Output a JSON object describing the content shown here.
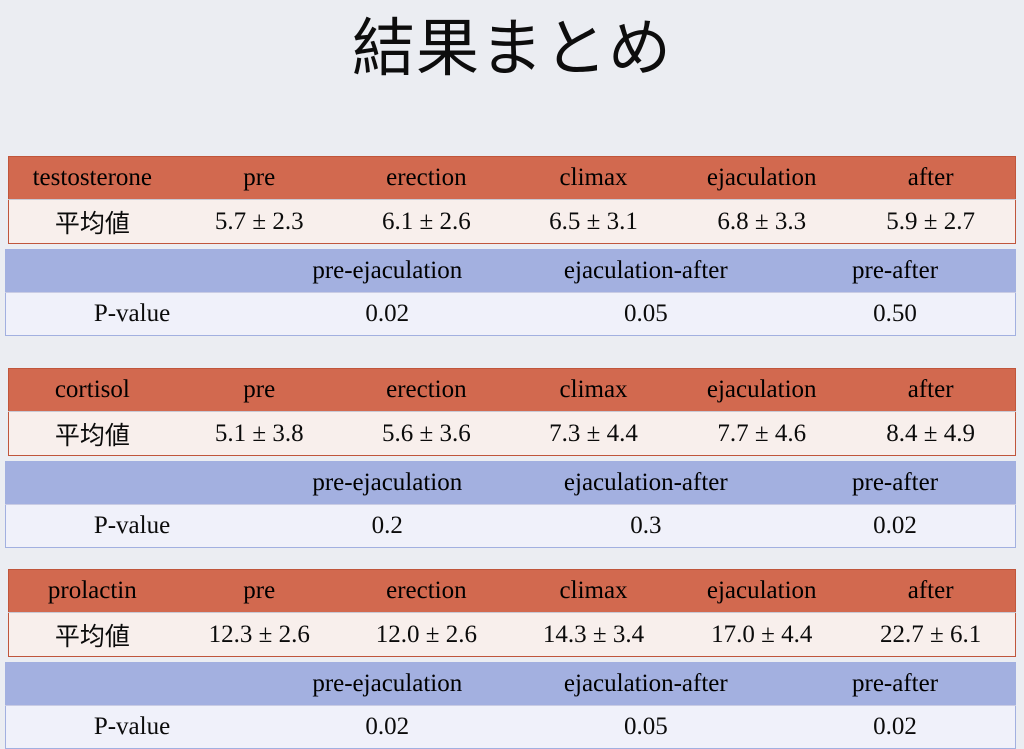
{
  "slide": {
    "title": "結果まとめ",
    "background_color": "#ebedf2",
    "header_orange": "#d2694f",
    "row_orange": "#f8efec",
    "header_blue": "#a3b0e0",
    "row_blue": "#f0f1fa",
    "significant_color": "#ff0000",
    "nonsignificant_color": "#2222ee"
  },
  "common": {
    "phase_headers": [
      "pre",
      "erection",
      "climax",
      "ejaculation",
      "after"
    ],
    "mean_label": "平均値",
    "pvalue_label": "P-value",
    "comparison_headers": [
      "pre-ejaculation",
      "ejaculation-after",
      "pre-after"
    ]
  },
  "tables": [
    {
      "hormone": "testosterone",
      "mean_row": {
        "label": "平均値",
        "values": [
          "5.7 ± 2.3",
          "6.1 ± 2.6",
          "6.5 ± 3.1",
          "6.8 ± 3.3",
          "5.9 ± 2.7"
        ]
      },
      "pvalue_row": {
        "label": "P-value",
        "values": [
          "0.02",
          "0.05",
          "0.50"
        ],
        "colors": [
          "#ff0000",
          "#ff0000",
          "#2222ee"
        ]
      }
    },
    {
      "hormone": "cortisol",
      "mean_row": {
        "label": "平均値",
        "values": [
          "5.1 ± 3.8",
          "5.6 ± 3.6",
          "7.3 ± 4.4",
          "7.7 ± 4.6",
          "8.4 ± 4.9"
        ]
      },
      "pvalue_row": {
        "label": "P-value",
        "values": [
          "0.2",
          "0.3",
          "0.02"
        ],
        "colors": [
          "#0b0b0b",
          "#0b0b0b",
          "#ff0000"
        ]
      }
    },
    {
      "hormone": "prolactin",
      "mean_row": {
        "label": "平均値",
        "values": [
          "12.3 ± 2.6",
          "12.0 ± 2.6",
          "14.3 ± 3.4",
          "17.0 ± 4.4",
          "22.7 ± 6.1"
        ]
      },
      "pvalue_row": {
        "label": "P-value",
        "values": [
          "0.02",
          "0.05",
          "0.02"
        ],
        "colors": [
          "#ff0000",
          "#ff0000",
          "#ff0000"
        ]
      }
    }
  ],
  "chart_data": {
    "type": "table",
    "title": "結果まとめ",
    "columns": [
      "hormone",
      "pre",
      "erection",
      "climax",
      "ejaculation",
      "after"
    ],
    "rows": [
      {
        "hormone": "testosterone",
        "pre": "5.7 ± 2.3",
        "erection": "6.1 ± 2.6",
        "climax": "6.5 ± 3.1",
        "ejaculation": "6.8 ± 3.3",
        "after": "5.9 ± 2.7"
      },
      {
        "hormone": "cortisol",
        "pre": "5.1 ± 3.8",
        "erection": "5.6 ± 3.6",
        "climax": "7.3 ± 4.4",
        "ejaculation": "7.7 ± 4.6",
        "after": "8.4 ± 4.9"
      },
      {
        "hormone": "prolactin",
        "pre": "12.3 ± 2.6",
        "erection": "12.0 ± 2.6",
        "climax": "14.3 ± 3.4",
        "ejaculation": "17.0 ± 4.4",
        "after": "22.7 ± 6.1"
      }
    ],
    "pvalue_columns": [
      "pre-ejaculation",
      "ejaculation-after",
      "pre-after"
    ],
    "pvalue_rows": [
      {
        "hormone": "testosterone",
        "pre-ejaculation": "0.02",
        "ejaculation-after": "0.05",
        "pre-after": "0.50"
      },
      {
        "hormone": "cortisol",
        "pre-ejaculation": "0.2",
        "ejaculation-after": "0.3",
        "pre-after": "0.02"
      },
      {
        "hormone": "prolactin",
        "pre-ejaculation": "0.02",
        "ejaculation-after": "0.05",
        "pre-after": "0.02"
      }
    ]
  }
}
